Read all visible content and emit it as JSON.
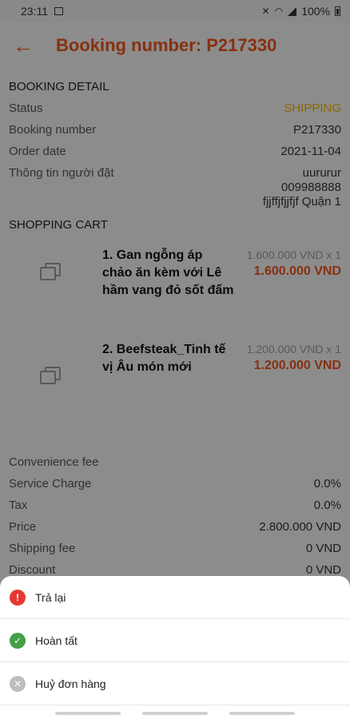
{
  "status_bar": {
    "time": "23:11",
    "battery": "100%"
  },
  "app_bar": {
    "back_icon": "arrow-left-icon",
    "title": "Booking number: P217330"
  },
  "booking_detail": {
    "section_title": "BOOKING DETAIL",
    "status_label": "Status",
    "status_value": "SHIPPING",
    "booking_number_label": "Booking number",
    "booking_number_value": "P217330",
    "order_date_label": "Order date",
    "order_date_value": "2021-11-04",
    "customer_label": "Thông tin người đặt",
    "customer_name": "uururur",
    "customer_phone": "009988888",
    "customer_address": "fjjffjfjjfjf Quận 1"
  },
  "cart": {
    "section_title": "SHOPPING CART",
    "items": [
      {
        "name": "1. Gan ngỗng áp chảo ăn kèm với Lê hầm vang đỏ sốt đấm",
        "qty": "1.600.000 VND x 1",
        "total": "1.600.000 VND"
      },
      {
        "name": "2. Beefsteak_Tinh tế vị Âu món mới",
        "qty": "1.200.000 VND x 1",
        "total": "1.200.000 VND"
      }
    ]
  },
  "summary": {
    "convenience_fee_label": "Convenience fee",
    "service_charge_label": "Service Charge",
    "service_charge_value": "0.0%",
    "tax_label": "Tax",
    "tax_value": "0.0%",
    "price_label": "Price",
    "price_value": "2.800.000 VND",
    "shipping_fee_label": "Shipping fee",
    "shipping_fee_value": "0 VND",
    "discount_label": "Discount",
    "discount_value": "0 VND"
  },
  "bottom_sheet": {
    "actions": [
      {
        "label": "Trả lại",
        "icon": "alert-icon",
        "color": "#e53935"
      },
      {
        "label": "Hoàn tất",
        "icon": "check-icon",
        "color": "#43a047"
      },
      {
        "label": "Huỷ đơn hàng",
        "icon": "cancel-icon",
        "color": "#bdbdbd"
      }
    ]
  },
  "colors": {
    "accent": "#e8541c",
    "status_shipping": "#f0b400"
  }
}
